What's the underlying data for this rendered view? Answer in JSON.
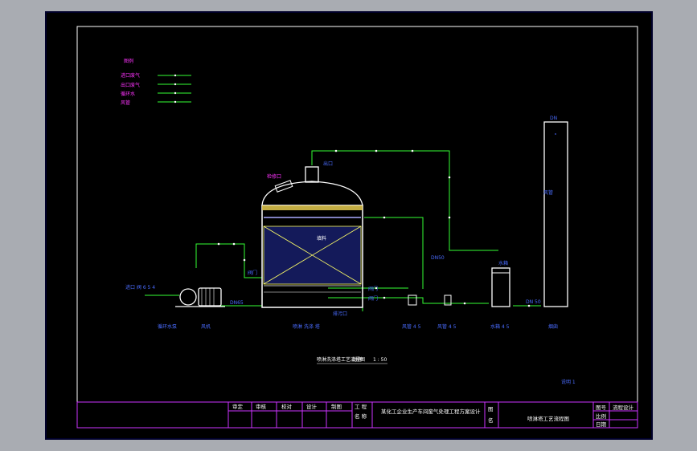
{
  "legend": {
    "title": "图例",
    "items": [
      {
        "label": "进口废气",
        "color": "#ff33ff"
      },
      {
        "label": "出口废气",
        "color": "#ff33ff"
      },
      {
        "label": "循环水",
        "color": "#ff33ff"
      },
      {
        "label": "风管",
        "color": "#ff33ff"
      }
    ]
  },
  "labels": {
    "manhole": "检修口",
    "outlet_top": "出口",
    "packing": "填料",
    "pump_inlet": "进口 阀 6 5 4",
    "pump_pipe": "DN65",
    "valve_right": "阀门",
    "pipe_mid": "DN50",
    "pipe_right": "DN 50",
    "drain": "排污口",
    "tank_top": "水箱",
    "chimney_top": "DN",
    "stack_mark": "风管",
    "eq_pump": "循环水泵",
    "eq_fan": "风机",
    "eq_tower": "喷淋 洗涤 塔",
    "eq_pipe1": "风管 4 5",
    "eq_pipe2": "风管 4 5",
    "eq_tank": "水箱 4 5",
    "eq_stack": "烟囱",
    "drawing_title": "喷淋洗涤塔工艺流程图",
    "scale_label": "比例",
    "scale_value": "1 : 50",
    "note": "说明 1",
    "valve_a": "阀门",
    "valve_b": "阀门"
  },
  "title_block": {
    "cells": [
      "审定",
      "审核",
      "校对",
      "设计",
      "制图"
    ],
    "project_label": "工 程",
    "project_sub": "名 称",
    "project_name": "某化工企业生产车间废气处理工程方案设计",
    "drawing_label": "图",
    "drawing_sub": "名",
    "drawing_name": "喷淋塔工艺流程图",
    "right_labels": [
      "图号",
      "比例",
      "日期"
    ],
    "right_value": "流程设计"
  }
}
